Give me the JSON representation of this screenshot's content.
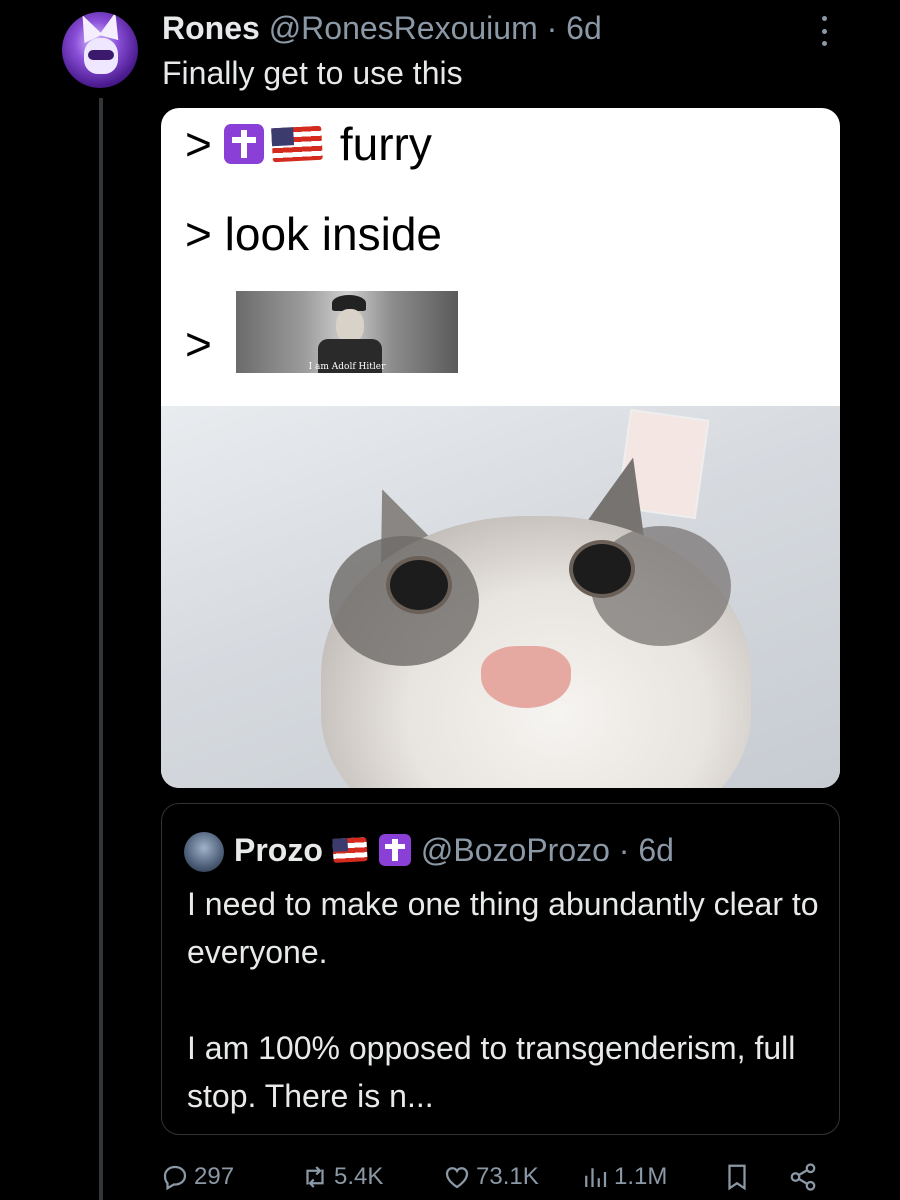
{
  "post": {
    "display_name": "Rones",
    "handle_time": "@RonesRexouium · 6d",
    "text": "Finally get to use this"
  },
  "meme": {
    "line1_prefix": ">",
    "line1_word": "furry",
    "line2": "> look inside",
    "line3_prefix": ">",
    "embedded_image_caption": "I am Adolf Hitler"
  },
  "quote": {
    "display_name": "Prozo",
    "handle_time": "@BozoProzo · 6d",
    "paragraph1": "I need to make one thing abundantly clear to everyone.",
    "paragraph2": "I am 100% opposed to transgenderism, full stop. There is n..."
  },
  "actions": {
    "replies": "297",
    "reposts": "5.4K",
    "likes": "73.1K",
    "views": "1.1M"
  },
  "icons": {
    "more": "more-dots-icon",
    "reply": "reply-icon",
    "repost": "repost-icon",
    "like": "heart-icon",
    "views": "views-chart-icon",
    "bookmark": "bookmark-icon",
    "share": "share-icon",
    "cross_emoji": "latin-cross-icon",
    "flag_emoji": "us-flag-icon"
  }
}
